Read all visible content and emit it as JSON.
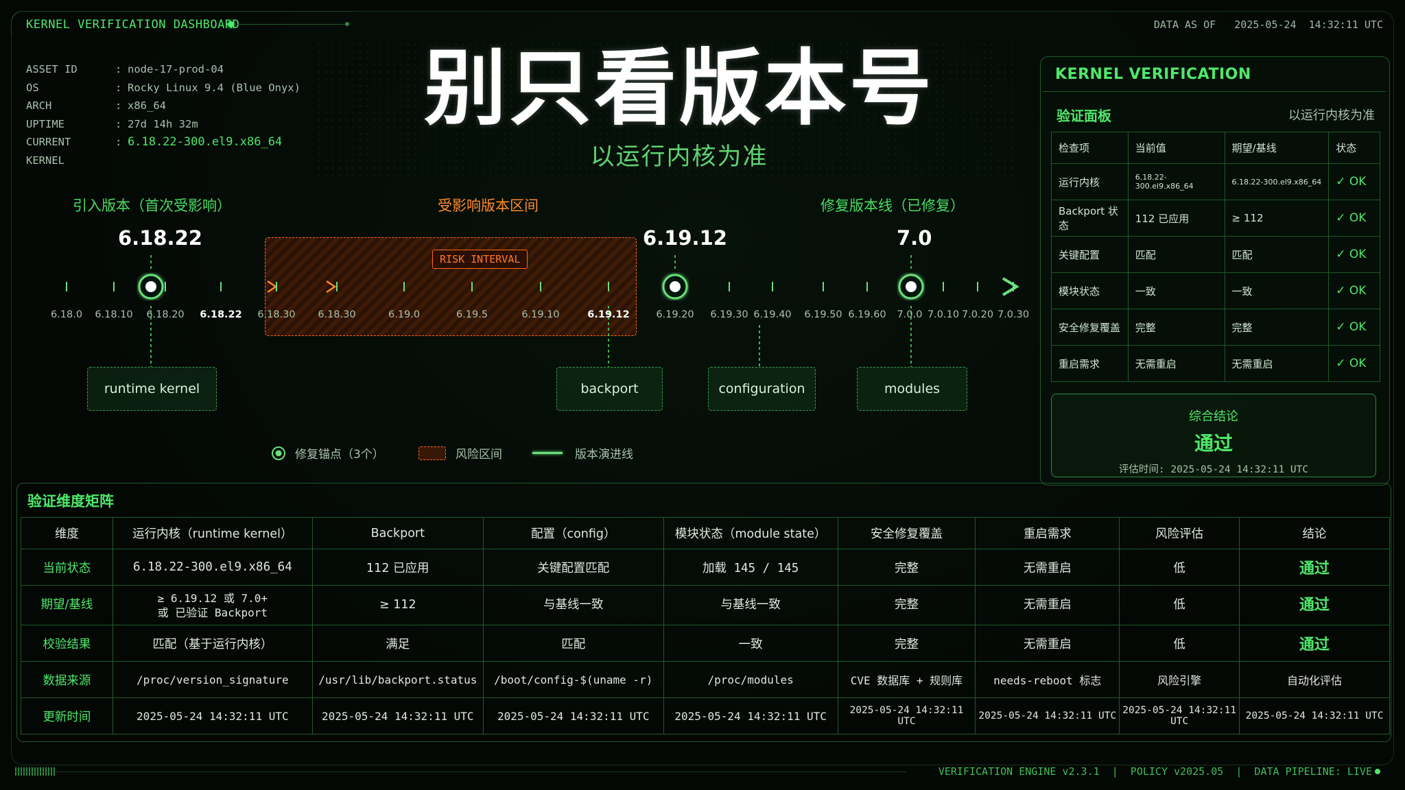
{
  "header": {
    "title": "KERNEL VERIFICATION DASHBOARD",
    "data_as_of": "DATA AS OF   2025-05-24  14:32:11 UTC"
  },
  "asset": [
    {
      "k": "ASSET ID",
      "v": "node-17-prod-04"
    },
    {
      "k": "OS",
      "v": "Rocky Linux 9.4 (Blue Onyx)"
    },
    {
      "k": "ARCH",
      "v": "x86_64"
    },
    {
      "k": "UPTIME",
      "v": "27d 14h 32m"
    },
    {
      "k": "CURRENT KERNEL",
      "v": "6.18.22-300.el9.x86_64"
    }
  ],
  "hero": {
    "title": "别只看版本号",
    "subtitle": "以运行内核为准"
  },
  "timeline": {
    "label_intro": "引入版本（首次受影响）",
    "label_affected": "受影响版本区间",
    "label_fixed": "修复版本线（已修复）",
    "risk_tag": "RISK INTERVAL",
    "versions": {
      "intro": "6.18.22",
      "fix1": "6.19.12",
      "fix2": "7.0"
    },
    "ticks": [
      {
        "label": "6.18.0",
        "bold": false
      },
      {
        "label": "6.18.10",
        "bold": false
      },
      {
        "label": "6.18.20",
        "bold": false
      },
      {
        "label": "6.18.22",
        "bold": true
      },
      {
        "label": "6.18.30",
        "bold": false
      },
      {
        "label": "6.18.30",
        "bold": false
      },
      {
        "label": "6.19.0",
        "bold": false
      },
      {
        "label": "6.19.5",
        "bold": false
      },
      {
        "label": "6.19.10",
        "bold": false
      },
      {
        "label": "6.19.12",
        "bold": true
      },
      {
        "label": "6.19.20",
        "bold": false
      },
      {
        "label": "6.19.30",
        "bold": false
      },
      {
        "label": "6.19.40",
        "bold": false
      },
      {
        "label": "6.19.50",
        "bold": false
      },
      {
        "label": "6.19.60",
        "bold": false
      },
      {
        "label": "7.0.0",
        "bold": false
      },
      {
        "label": "7.0.10",
        "bold": false
      },
      {
        "label": "7.0.20",
        "bold": false
      },
      {
        "label": "7.0.30",
        "bold": false
      }
    ],
    "tags": [
      "runtime kernel",
      "backport",
      "configuration",
      "modules"
    ]
  },
  "legend": {
    "anchor": "修复锚点（3个）",
    "risk": "风险区间",
    "line": "版本演进线"
  },
  "panel": {
    "title": "KERNEL VERIFICATION",
    "subtitle": "验证面板",
    "subtitle_right": "以运行内核为准",
    "headers": [
      "检查项",
      "当前值",
      "期望/基线",
      "状态"
    ],
    "rows": [
      [
        "运行内核",
        "6.18.22-300.el9.x86_64",
        "6.18.22-300.el9.x86_64",
        "✓ OK"
      ],
      [
        "Backport 状态",
        "112 已应用",
        "≥ 112",
        "✓ OK"
      ],
      [
        "关键配置",
        "匹配",
        "匹配",
        "✓ OK"
      ],
      [
        "模块状态",
        "一致",
        "一致",
        "✓ OK"
      ],
      [
        "安全修复覆盖",
        "完整",
        "完整",
        "✓ OK"
      ],
      [
        "重启需求",
        "无需重启",
        "无需重启",
        "✓ OK"
      ]
    ],
    "conclusion_label": "综合结论",
    "conclusion_value": "通过",
    "conclusion_time": "评估时间: 2025-05-24 14:32:11 UTC"
  },
  "matrix": {
    "title": "验证维度矩阵",
    "headers": [
      "维度",
      "运行内核（runtime kernel）",
      "Backport",
      "配置（config）",
      "模块状态（module state）",
      "安全修复覆盖",
      "重启需求",
      "风险评估",
      "结论"
    ],
    "rows": [
      {
        "label": "当前状态",
        "cells": [
          "6.18.22-300.el9.x86_64",
          "112 已应用",
          "关键配置匹配",
          "加载 145 / 145",
          "完整",
          "无需重启",
          "低",
          "通过"
        ]
      },
      {
        "label": "期望/基线",
        "cells": [
          "≥ 6.19.12 或 7.0+\n或 已验证 Backport",
          "≥ 112",
          "与基线一致",
          "与基线一致",
          "完整",
          "无需重启",
          "低",
          "通过"
        ]
      },
      {
        "label": "校验结果",
        "cells": [
          "匹配（基于运行内核）",
          "满足",
          "匹配",
          "一致",
          "完整",
          "无需重启",
          "低",
          "通过"
        ]
      },
      {
        "label": "数据来源",
        "cells": [
          "/proc/version_signature",
          "/usr/lib/backport.status",
          "/boot/config-$(uname -r)",
          "/proc/modules",
          "CVE 数据库 + 规则库",
          "needs-reboot 标志",
          "风险引擎",
          "自动化评估"
        ]
      },
      {
        "label": "更新时间",
        "cells": [
          "2025-05-24 14:32:11 UTC",
          "2025-05-24 14:32:11 UTC",
          "2025-05-24 14:32:11 UTC",
          "2025-05-24 14:32:11 UTC",
          "2025-05-24 14:32:11 UTC",
          "2025-05-24 14:32:11 UTC",
          "2025-05-24 14:32:11 UTC",
          "2025-05-24 14:32:11 UTC"
        ]
      }
    ]
  },
  "footer": {
    "status": "VERIFICATION ENGINE v2.3.1  |  POLICY v2025.05  |  DATA PIPELINE: LIVE"
  },
  "colors": {
    "accent": "#4ee86a",
    "risk": "#ff6a1a",
    "background": "#040805"
  }
}
